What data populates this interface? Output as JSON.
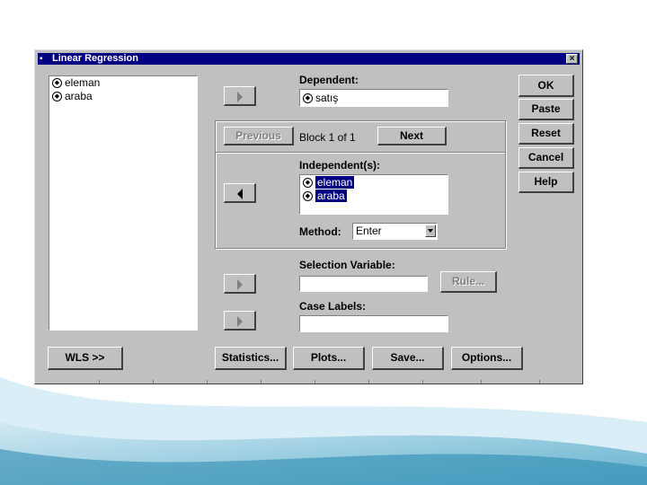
{
  "window": {
    "title": "Linear Regression",
    "close_label": "×"
  },
  "source_list": [
    {
      "label": "eleman"
    },
    {
      "label": "araba"
    }
  ],
  "dependent": {
    "label": "Dependent:",
    "value": "satış"
  },
  "block": {
    "previous_label": "Previous",
    "text": "Block 1 of 1",
    "next_label": "Next"
  },
  "independents": {
    "label": "Independent(s):",
    "items": [
      {
        "label": "eleman"
      },
      {
        "label": "araba"
      }
    ]
  },
  "method": {
    "label": "Method:",
    "value": "Enter"
  },
  "selection": {
    "label": "Selection Variable:",
    "value": "",
    "rule_label": "Rule..."
  },
  "case_labels": {
    "label": "Case Labels:",
    "value": ""
  },
  "buttons": {
    "ok": "OK",
    "paste": "Paste",
    "reset": "Reset",
    "cancel": "Cancel",
    "help": "Help",
    "wls": "WLS >>",
    "statistics": "Statistics...",
    "plots": "Plots...",
    "save": "Save...",
    "options": "Options..."
  },
  "colors": {
    "dialog_bg": "#c0c0c0",
    "titlebar": "#000080",
    "selection": "#000080"
  },
  "icons": {
    "variable": "ruler-variable-icon",
    "arrow_right": "right-arrow-icon",
    "arrow_left": "left-arrow-icon"
  }
}
